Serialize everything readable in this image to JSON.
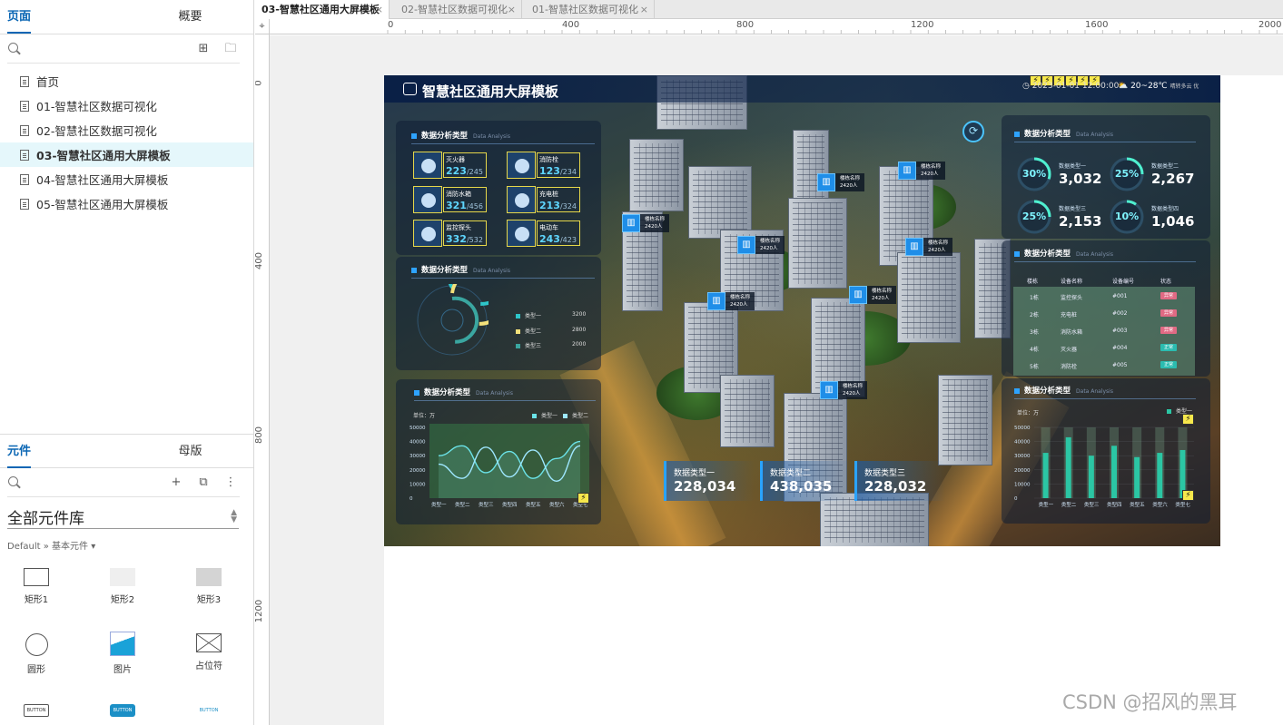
{
  "left": {
    "tabs": {
      "pages": "页面",
      "outline": "概要"
    },
    "pages": [
      {
        "label": "首页"
      },
      {
        "label": "01-智慧社区数据可视化"
      },
      {
        "label": "02-智慧社区数据可视化"
      },
      {
        "label": "03-智慧社区通用大屏模板"
      },
      {
        "label": "04-智慧社区通用大屏模板"
      },
      {
        "label": "05-智慧社区通用大屏模板"
      }
    ],
    "selected_page_index": 3,
    "lib_tabs": {
      "components": "元件",
      "masters": "母版"
    },
    "library": {
      "title": "全部元件库",
      "subtitle": "Default » 基本元件 ▾"
    },
    "widgets": [
      {
        "label": "矩形1"
      },
      {
        "label": "矩形2"
      },
      {
        "label": "矩形3"
      },
      {
        "label": "圆形"
      },
      {
        "label": "图片"
      },
      {
        "label": "占位符"
      },
      {
        "label": "BUTTON"
      },
      {
        "label": "BUTTON"
      },
      {
        "label": "BUTTON"
      }
    ]
  },
  "doc_tabs": [
    {
      "label": "03-智慧社区通用大屏模板",
      "active": true
    },
    {
      "label": "02-智慧社区数据可视化",
      "active": false
    },
    {
      "label": "01-智慧社区数据可视化",
      "active": false
    }
  ],
  "ruler": {
    "top_labels": [
      "0",
      "400",
      "800",
      "1200",
      "1600",
      "2000"
    ],
    "left_labels": [
      "0",
      "400",
      "800",
      "1200"
    ],
    "corner": "⌖"
  },
  "dashboard": {
    "title": "智慧社区通用大屏模板",
    "datetime": "2023-01-01 12:00:00",
    "weather_temp": "20~28℃",
    "weather_desc": "晴转多云  优",
    "bolt": "⚡",
    "left_panel_1": {
      "title": "数据分析类型",
      "subtitle": "Data Analysis",
      "devices": [
        {
          "name": "灭火器",
          "value": "223",
          "total": "/245"
        },
        {
          "name": "消防栓",
          "value": "123",
          "total": "/234"
        },
        {
          "name": "消防水箱",
          "value": "321",
          "total": "/456"
        },
        {
          "name": "充电桩",
          "value": "213",
          "total": "/324"
        },
        {
          "name": "监控探头",
          "value": "332",
          "total": "/532"
        },
        {
          "name": "电动车",
          "value": "243",
          "total": "/423"
        }
      ]
    },
    "left_panel_2": {
      "title": "数据分析类型",
      "subtitle": "Data Analysis",
      "legend": [
        {
          "name": "类型一",
          "value": "3200",
          "color": "#2ec5c9"
        },
        {
          "name": "类型二",
          "value": "2800",
          "color": "#f2e07a"
        },
        {
          "name": "类型三",
          "value": "2000",
          "color": "#3aa6a0"
        }
      ]
    },
    "left_panel_3": {
      "title": "数据分析类型",
      "subtitle": "Data Analysis",
      "unit": "单位：万",
      "legend": [
        "类型一",
        "类型二"
      ]
    },
    "right_panel_1": {
      "title": "数据分析类型",
      "subtitle": "Data Analysis",
      "rings": [
        {
          "pct": "30%",
          "name": "数据类型一",
          "value": "3,032"
        },
        {
          "pct": "25%",
          "name": "数据类型二",
          "value": "2,267"
        },
        {
          "pct": "25%",
          "name": "数据类型三",
          "value": "2,153"
        },
        {
          "pct": "10%",
          "name": "数据类型四",
          "value": "1,046"
        }
      ]
    },
    "right_panel_2": {
      "title": "数据分析类型",
      "subtitle": "Data Analysis",
      "headers": [
        "楼栋",
        "设备名称",
        "设备编号",
        "状态"
      ],
      "rows": [
        [
          "1栋",
          "监控探头",
          "#001",
          "异常"
        ],
        [
          "2栋",
          "充电桩",
          "#002",
          "异常"
        ],
        [
          "3栋",
          "消防水箱",
          "#003",
          "异常"
        ],
        [
          "4栋",
          "灭火器",
          "#004",
          "正常"
        ],
        [
          "5栋",
          "消防栓",
          "#005",
          "正常"
        ]
      ],
      "status_colors": {
        "异常": "#e06a84",
        "正常": "#2bbcb0"
      }
    },
    "right_panel_3": {
      "title": "数据分析类型",
      "subtitle": "Data Analysis",
      "unit": "单位：万",
      "legend": "类型一"
    },
    "building_labels": [
      {
        "name": "楼栋名称",
        "count": "2420人"
      },
      {
        "name": "楼栋名称",
        "count": "2420人"
      },
      {
        "name": "楼栋名称",
        "count": "2420人"
      },
      {
        "name": "楼栋名称",
        "count": "2420人"
      },
      {
        "name": "楼栋名称",
        "count": "2420人"
      },
      {
        "name": "楼栋名称",
        "count": "2420人"
      },
      {
        "name": "楼栋名称",
        "count": "2420人"
      },
      {
        "name": "楼栋名称",
        "count": "2420人"
      },
      {
        "name": "楼栋名称",
        "count": "2420人"
      }
    ],
    "big_stats": [
      {
        "label": "数据类型一",
        "value": "228,034"
      },
      {
        "label": "数据类型二",
        "value": "438,035"
      },
      {
        "label": "数据类型三",
        "value": "228,032"
      }
    ]
  },
  "chart_data": [
    {
      "type": "area",
      "categories": [
        "类型一",
        "类型二",
        "类型三",
        "类型四",
        "类型五",
        "类型六",
        "类型七"
      ],
      "ylim": [
        0,
        50000
      ],
      "yticks": [
        "50000",
        "40000",
        "30000",
        "20000",
        "10000",
        "0"
      ],
      "series": [
        {
          "name": "类型一",
          "values": [
            30000,
            37000,
            18000,
            33000,
            14000,
            28000,
            40000
          ],
          "color": "#6be3e8"
        },
        {
          "name": "类型二",
          "values": [
            24000,
            14000,
            36000,
            15000,
            34000,
            12000,
            37000
          ],
          "color": "#9ee7ff"
        }
      ]
    },
    {
      "type": "bar",
      "categories": [
        "类型一",
        "类型二",
        "类型三",
        "类型四",
        "类型五",
        "类型六",
        "类型七"
      ],
      "ylim": [
        0,
        50000
      ],
      "yticks": [
        "50000",
        "40000",
        "30000",
        "20000",
        "10000",
        "0"
      ],
      "series": [
        {
          "name": "类型一",
          "values": [
            32000,
            43000,
            30000,
            37000,
            29000,
            32000,
            34000
          ],
          "color": "#2bc6a4"
        }
      ]
    },
    {
      "type": "pie",
      "categories": [
        "类型一",
        "类型二",
        "类型三"
      ],
      "values": [
        3200,
        2800,
        2000
      ]
    }
  ],
  "watermark": "CSDN @招风的黑耳"
}
